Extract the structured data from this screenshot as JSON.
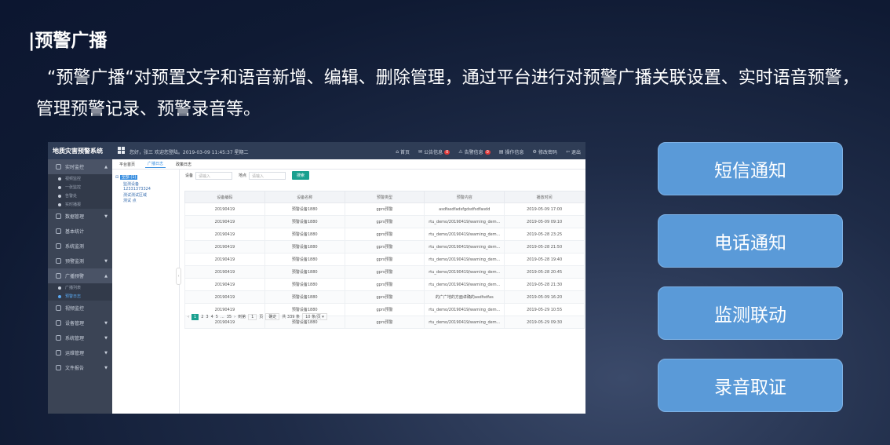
{
  "slide": {
    "title": "|预警广播",
    "description": "“预警广播“对预置文字和语音新增、编辑、删除管理，通过平台进行对预警广播关联设置、实时语音预警，管理预警记录、预警录音等。"
  },
  "buttons": [
    "短信通知",
    "电话通知",
    "监测联动",
    "录音取证"
  ],
  "screenshot": {
    "app_title": "地质灾害预警系统",
    "welcome": "您好，张三 欢迎您登陆。2019-03-09 11:45:37 星期二",
    "nav": [
      {
        "label": "首页",
        "badge": ""
      },
      {
        "label": "公告信息",
        "badge": "0"
      },
      {
        "label": "告警信息",
        "badge": "0"
      },
      {
        "label": "操作信息",
        "badge": ""
      },
      {
        "label": "修改密码",
        "badge": ""
      },
      {
        "label": "退出",
        "badge": ""
      }
    ],
    "sidebar": [
      {
        "label": "实时监控",
        "sub": [
          "视频监控",
          "一张监控",
          "告警处",
          "实时播报"
        ]
      },
      {
        "label": "数据管理"
      },
      {
        "label": "基本统计"
      },
      {
        "label": "系统监测"
      },
      {
        "label": "预警监测"
      },
      {
        "label": "广播预警",
        "sub": [
          "广播列表",
          "预警日志"
        ]
      },
      {
        "label": "视频监控"
      },
      {
        "label": "设备管理"
      },
      {
        "label": "系统管理"
      },
      {
        "label": "运维管理"
      },
      {
        "label": "文件报告"
      }
    ],
    "tabs": [
      "平台首页",
      "广播日志",
      "政策日志"
    ],
    "tree": {
      "root": "全部 (1)",
      "nodes": [
        "监测设备",
        "12331373324",
        "测试测试区域",
        "测试 点"
      ]
    },
    "form": {
      "label1": "设备",
      "placeholder1": "请输入",
      "label2": "地点",
      "placeholder2": "请输入",
      "button": "搜索"
    },
    "table": {
      "headers": [
        "设备编码",
        "设备名称",
        "预警类型",
        "预警内容",
        "播放时间"
      ],
      "rows": [
        [
          "20190419",
          "预警设备1880",
          "gprs预警",
          "asdfasdfadsfgdsdfsdfasdd",
          "2019-05-09 17:00"
        ],
        [
          "20190419",
          "预警设备1880",
          "gprs预警",
          "rtu_demo/20190419/warning_dem...",
          "2019-05-09 09:10"
        ],
        [
          "20190419",
          "预警设备1880",
          "gprs预警",
          "rtu_demo/20190419/warning_dem...",
          "2019-05-28 23:25"
        ],
        [
          "20190419",
          "预警设备1880",
          "gprs预警",
          "rtu_demo/20190419/warning_dem...",
          "2019-05-28 21:50"
        ],
        [
          "20190419",
          "预警设备1880",
          "gprs预警",
          "rtu_demo/20190419/warning_dem...",
          "2019-05-28 19:40"
        ],
        [
          "20190419",
          "预警设备1880",
          "gprs预警",
          "rtu_demo/20190419/warning_dem...",
          "2019-05-28 20:45"
        ],
        [
          "20190419",
          "预警设备1880",
          "gprs预警",
          "rtu_demo/20190419/warning_dem...",
          "2019-05-28 21:30"
        ],
        [
          "20190419",
          "预警设备1880",
          "gprs预警",
          "的广广地的方面卓确的asdfsdfas",
          "2019-05-09 16:20"
        ],
        [
          "20190419",
          "预警设备1880",
          "gprs预警",
          "rtu_demo/20190419/warning_dem...",
          "2019-05-29 10:55"
        ],
        [
          "20190419",
          "预警设备1880",
          "gprs预警",
          "rtu_demo/20190419/warning_dem...",
          "2019-05-29 09:30"
        ]
      ]
    },
    "pager": {
      "pages": [
        "1",
        "2",
        "3",
        "4",
        "5",
        "...",
        "35"
      ],
      "goto_label": "到第",
      "goto_value": "1",
      "unit": "页",
      "confirm": "确定",
      "total": "共 339 条",
      "size": "10 条/页"
    }
  }
}
